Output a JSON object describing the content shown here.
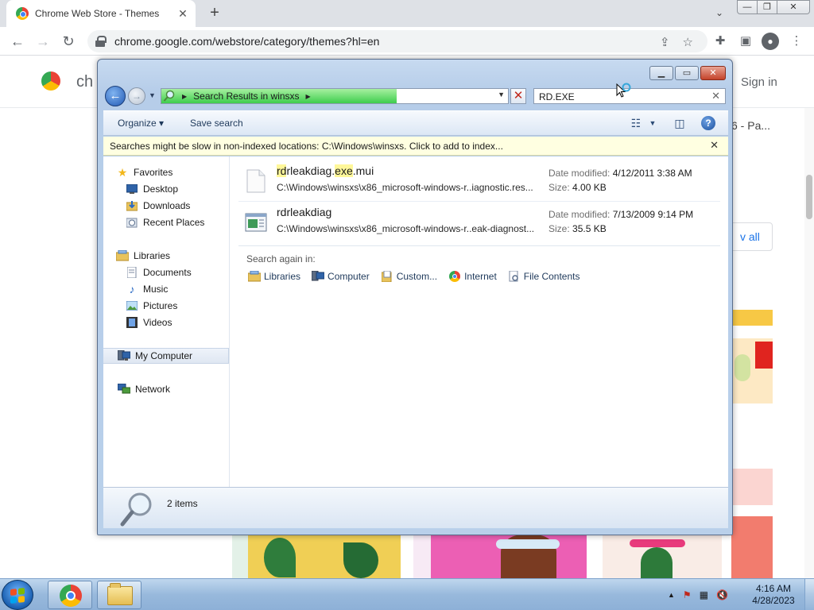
{
  "browser": {
    "tab_title": "Chrome Web Store - Themes",
    "tab_close": "✕",
    "new_tab": "+",
    "tab_search": "⌄",
    "url": "chrome.google.com/webstore/category/themes?hl=en"
  },
  "page": {
    "logo_text": "ch",
    "sign_in": "Sign in",
    "side_text": "6 - Pa...",
    "view_all": "v all"
  },
  "explorer": {
    "address_text": "Search Results in winsxs",
    "search_value": "RD.EXE",
    "search_progress": 0.68,
    "organize": "Organize",
    "save_search": "Save search",
    "info_bar": "Searches might be slow in non-indexed locations: C:\\Windows\\winsxs. Click to add to index...",
    "nav": {
      "favorites": "Favorites",
      "desktop": "Desktop",
      "downloads": "Downloads",
      "recent_places": "Recent Places",
      "libraries": "Libraries",
      "documents": "Documents",
      "music": "Music",
      "pictures": "Pictures",
      "videos": "Videos",
      "my_computer": "My Computer",
      "network": "Network"
    },
    "results": [
      {
        "name_parts": [
          "rd",
          "rleakdiag.",
          "exe",
          ".mui"
        ],
        "path": "C:\\Windows\\winsxs\\x86_microsoft-windows-r..iagnostic.res...",
        "date_label": "Date modified:",
        "date": "4/12/2011 3:38 AM",
        "size_label": "Size:",
        "size": "4.00 KB"
      },
      {
        "name": "rdrleakdiag",
        "path": "C:\\Windows\\winsxs\\x86_microsoft-windows-r..eak-diagnost...",
        "date_label": "Date modified:",
        "date": "7/13/2009 9:14 PM",
        "size_label": "Size:",
        "size": "35.5 KB"
      }
    ],
    "search_again_label": "Search again in:",
    "search_again": {
      "libraries": "Libraries",
      "computer": "Computer",
      "custom": "Custom...",
      "internet": "Internet",
      "file_contents": "File Contents"
    },
    "item_count": "2 items"
  },
  "taskbar": {
    "time": "4:16 AM",
    "date": "4/28/2023"
  },
  "colors": {
    "highlight": "#fff799",
    "info_bar": "#ffffe1",
    "progress": "#3ecd4e"
  }
}
